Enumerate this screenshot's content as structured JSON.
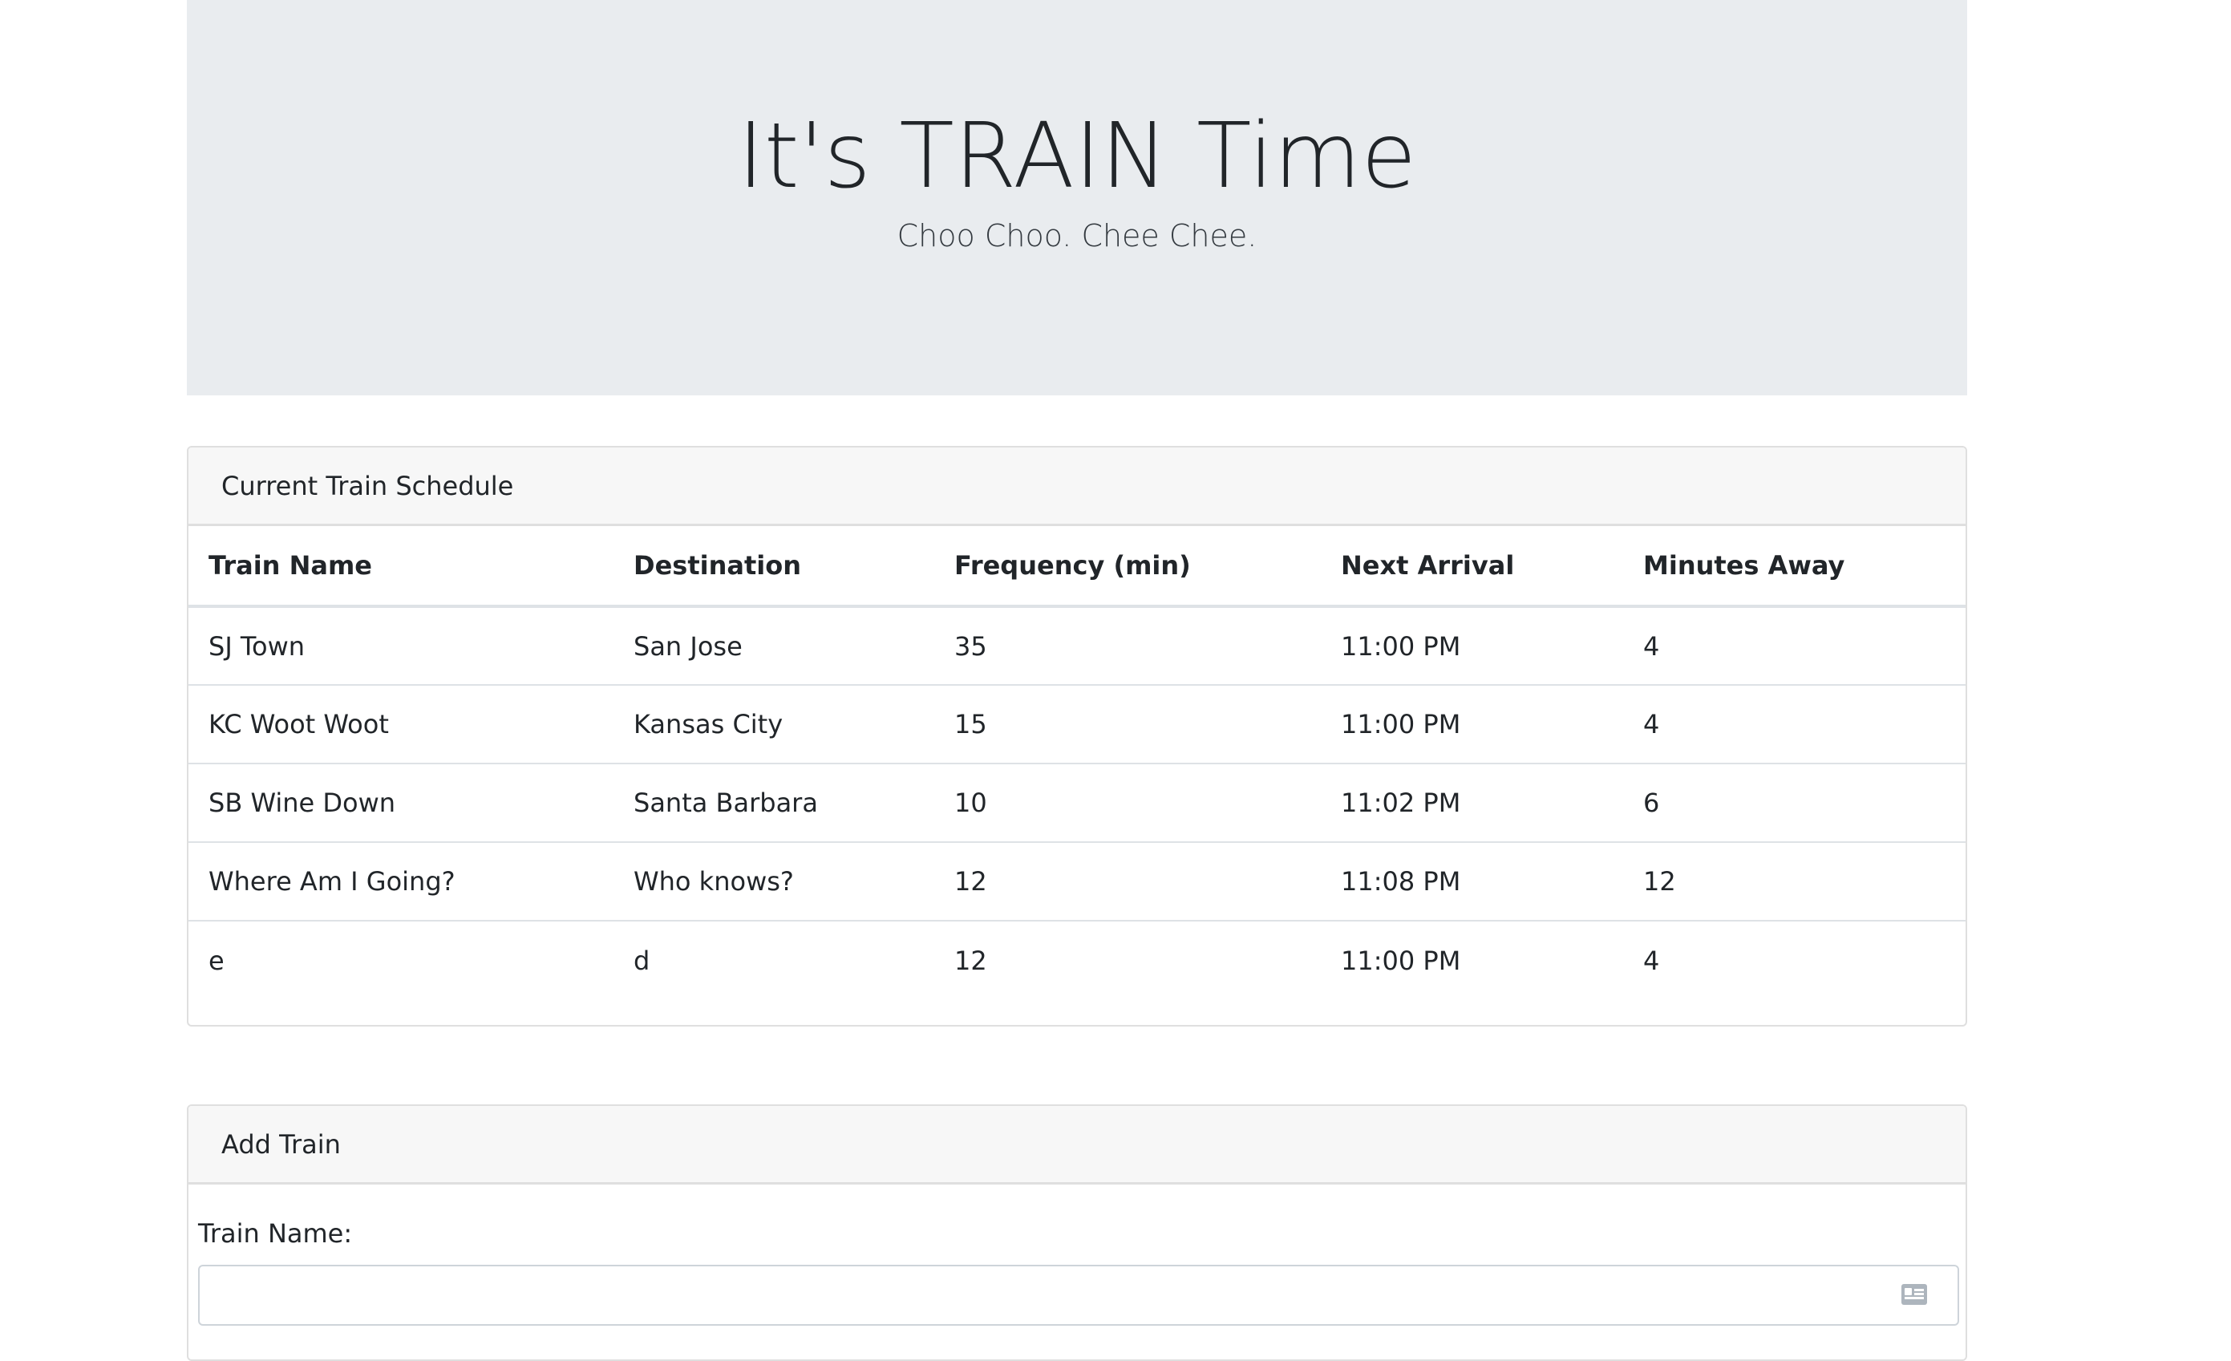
{
  "jumbotron": {
    "title": "It's TRAIN Time",
    "lead": "Choo Choo. Chee Chee."
  },
  "schedule": {
    "header": "Current Train Schedule",
    "columns": [
      "Train Name",
      "Destination",
      "Frequency (min)",
      "Next Arrival",
      "Minutes Away"
    ],
    "rows": [
      [
        "SJ Town",
        "San Jose",
        "35",
        "11:00 PM",
        "4"
      ],
      [
        "KC Woot Woot",
        "Kansas City",
        "15",
        "11:00 PM",
        "4"
      ],
      [
        "SB Wine Down",
        "Santa Barbara",
        "10",
        "11:02 PM",
        "6"
      ],
      [
        "Where Am I Going?",
        "Who knows?",
        "12",
        "11:08 PM",
        "12"
      ],
      [
        "e",
        "d",
        "12",
        "11:00 PM",
        "4"
      ]
    ]
  },
  "add_train": {
    "header": "Add Train",
    "train_name_label": "Train Name:",
    "train_name_value": "",
    "autofill_icon": "contact-card-icon"
  }
}
